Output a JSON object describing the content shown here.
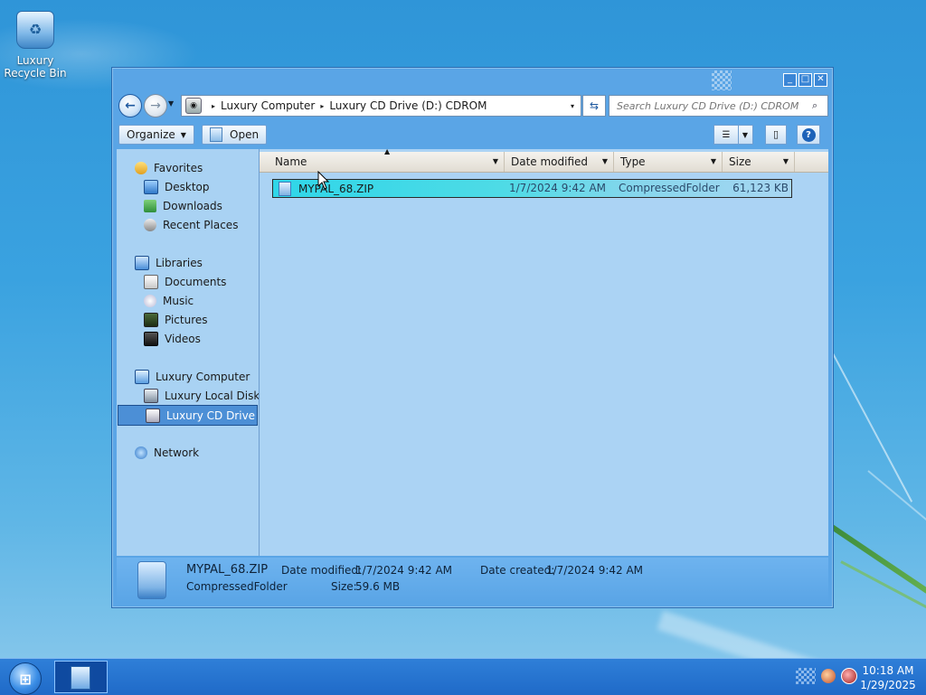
{
  "desktop": {
    "recycle_bin_label_line1": "Luxury",
    "recycle_bin_label_line2": "Recycle Bin"
  },
  "window": {
    "controls": {
      "minimize": "_",
      "maximize": "□",
      "close": "✕"
    },
    "address_bar": {
      "segments": [
        "Luxury Computer",
        "Luxury CD Drive (D:) CDROM"
      ],
      "separator": "▸",
      "dropdown": "▾"
    },
    "search": {
      "placeholder": "Search Luxury CD Drive (D:) CDROM",
      "icon": "search-icon"
    },
    "toolbar": {
      "organize_label": "Organize",
      "open_label": "Open"
    },
    "nav_pane": {
      "favorites": {
        "label": "Favorites",
        "items": [
          "Desktop",
          "Downloads",
          "Recent Places"
        ]
      },
      "libraries": {
        "label": "Libraries",
        "items": [
          "Documents",
          "Music",
          "Pictures",
          "Videos"
        ]
      },
      "computer": {
        "label": "Luxury Computer",
        "items": [
          "Luxury Local Disk (C:)",
          "Luxury CD Drive (D:)"
        ],
        "selected_item": "Luxury CD Drive (D:)"
      },
      "network": {
        "label": "Network"
      }
    },
    "file_list": {
      "columns": [
        "Name",
        "Date modified",
        "Type",
        "Size"
      ],
      "sort_column": "Name",
      "rows": [
        {
          "name": "MYPAL_68.ZIP",
          "date_modified": "1/7/2024 9:42 AM",
          "type": "CompressedFolder",
          "size": "61,123 KB",
          "selected": true
        }
      ]
    },
    "details_pane": {
      "name": "MYPAL_68.ZIP",
      "type": "CompressedFolder",
      "date_modified_label": "Date modified:",
      "date_modified": "1/7/2024 9:42 AM",
      "date_created_label": "Date created:",
      "date_created": "1/7/2024 9:42 AM",
      "size_label": "Size:",
      "size": "59.6 MB"
    }
  },
  "taskbar": {
    "start_icon": "windows-logo-icon",
    "clock_time": "10:18 AM",
    "clock_date": "1/29/2025"
  },
  "colors": {
    "window_frame": "#5aa5e6",
    "selection": "#2fd6e8",
    "taskbar": "#1f6ac8"
  }
}
